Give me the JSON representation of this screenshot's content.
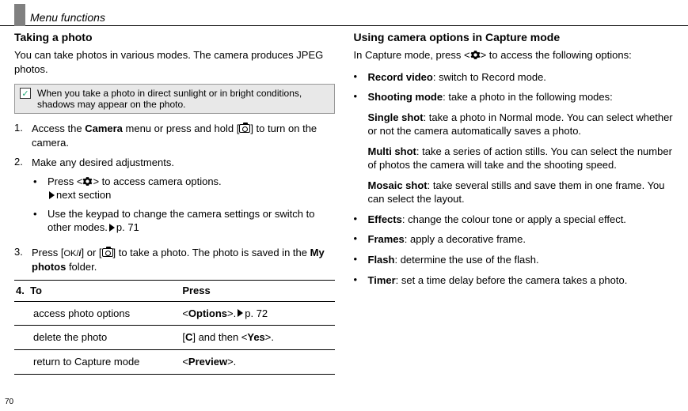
{
  "page": {
    "number": "70",
    "header": "Menu functions"
  },
  "left": {
    "title": "Taking a photo",
    "intro": "You can take photos in various modes. The camera produces JPEG photos.",
    "note": "When you take a photo in direct sunlight or in bright conditions, shadows may appear on the photo.",
    "step1_a": "Access the ",
    "step1_b": "Camera",
    "step1_c": " menu or press and hold [",
    "step1_d": "] to turn on the camera.",
    "step2": "Make any desired adjustments.",
    "step2_sub1_a": "Press <",
    "step2_sub1_b": "> to access camera options.",
    "step2_sub1_c": "next section",
    "step2_sub2_a": "Use the keypad to change the camera settings or switch to other modes.",
    "step2_sub2_b": "p. 71",
    "step3_a": "Press [",
    "step3_b": "] or [",
    "step3_c": "] to take a photo. The photo is saved in the ",
    "step3_d": "My photos",
    "step3_e": " folder.",
    "step_num4": "4.",
    "table": {
      "hdr_to": "To",
      "hdr_press": "Press",
      "rows": [
        {
          "to": "access photo options",
          "press_a": "<",
          "press_b": "Options",
          "press_c": ">.",
          "press_d": "p. 72"
        },
        {
          "to": "delete the photo",
          "press_a": "[",
          "press_b": "C",
          "press_c": "] and then <",
          "press_d": "Yes",
          "press_e": ">."
        },
        {
          "to": "return to Capture mode",
          "press_a": " <",
          "press_b": "Preview",
          "press_c": ">."
        }
      ]
    }
  },
  "right": {
    "title": "Using camera options in Capture mode",
    "intro_a": "In Capture mode, press <",
    "intro_b": "> to access the following options:",
    "items": [
      {
        "key": "Record video",
        "text": ": switch to Record mode."
      },
      {
        "key": "Shooting mode",
        "text": ": take a photo in the following modes:"
      }
    ],
    "modes": [
      {
        "key": "Single shot",
        "text": ": take a photo in Normal mode. You can select whether or not the camera automatically saves a photo."
      },
      {
        "key": "Multi shot",
        "text": ": take a series of action stills. You can select the number of photos the camera will take and the shooting speed."
      },
      {
        "key": "Mosaic shot",
        "text": ": take several stills and save them in one frame. You can select the layout."
      }
    ],
    "items2": [
      {
        "key": "Effects",
        "text": ": change the colour tone or apply a special effect."
      },
      {
        "key": "Frames",
        "text": ": apply a decorative frame."
      },
      {
        "key": "Flash",
        "text": ": determine the use of the flash."
      },
      {
        "key": "Timer",
        "text": ": set a time delay before the camera takes a photo."
      }
    ]
  }
}
